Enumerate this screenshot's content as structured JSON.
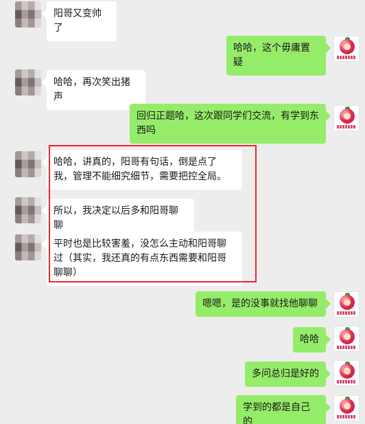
{
  "messages": [
    {
      "side": "left",
      "text": "阳哥又变帅了"
    },
    {
      "side": "right",
      "text": "哈哈，这个毋庸置疑"
    },
    {
      "side": "left",
      "text": "哈哈，再次笑出猪声"
    },
    {
      "side": "right",
      "text": "回归正题哈，这次跟同学们交流，有学到东西吗"
    },
    {
      "side": "left",
      "text": "哈哈，讲真的，阳哥有句话，倒是点了我，管理不能细究细节，需要把控全局。"
    },
    {
      "side": "left",
      "text": "所以，我决定以后多和阳哥聊聊"
    },
    {
      "side": "left",
      "text": "平时也是比较害羞，没怎么主动和阳哥聊过（其实，我还真的有点东西需要和阳哥聊聊）"
    },
    {
      "side": "right",
      "text": "嗯嗯，是的没事就找他聊聊"
    },
    {
      "side": "right",
      "text": "哈哈"
    },
    {
      "side": "right",
      "text": "多问总归是好的"
    },
    {
      "side": "right",
      "text": "学到的都是自己的"
    }
  ],
  "colors": {
    "background": "#ededed",
    "bubble_self": "#95ec69",
    "bubble_other": "#ffffff",
    "highlight": "#e6272e"
  },
  "icons": {
    "other_avatar": "blurred-avatar",
    "self_avatar": "tomato-mascot-avatar"
  }
}
